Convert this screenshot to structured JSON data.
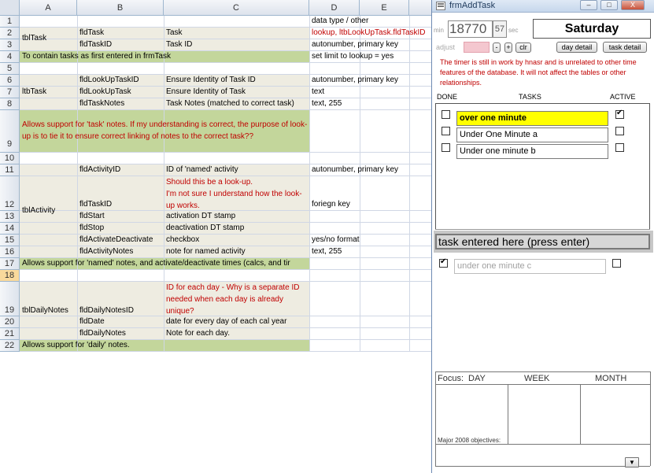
{
  "sheet": {
    "columns": [
      "A",
      "B",
      "C",
      "D",
      "E"
    ],
    "rows": [
      "1",
      "2",
      "3",
      "4",
      "5",
      "6",
      "7",
      "8",
      "9",
      "10",
      "11",
      "12",
      "13",
      "14",
      "15",
      "16",
      "17",
      "18",
      "19",
      "20",
      "21",
      "22"
    ],
    "cells": {
      "d1": "data type / other",
      "a2": "tblTask",
      "b2": "fldTask",
      "c2": "Task",
      "d2": "lookup, ltbLookUpTask.fldTaskID",
      "b3": "fldTaskID",
      "c3": "Task ID",
      "d3": "autonumber, primary key",
      "a4": "To contain tasks as first entered in frmTask",
      "d4": "set limit to lookup = yes",
      "a7": "ltbTask",
      "b6": "fldLookUpTaskID",
      "c6": "Ensure Identity of Task ID",
      "d6": "autonumber, primary key",
      "b7": "fldLookUpTask",
      "c7": "Ensure Identity of Task",
      "d7": "text",
      "b8": "fldTaskNotes",
      "c8": "Task Notes (matched to correct task)",
      "d8": "text, 255",
      "a9": "Allows support for 'task' notes.  If my understanding is correct, the purpose of look-up is to tie it to ensure correct linking of notes to the correct task??",
      "b11": "fldActivityID",
      "c11": "ID of 'named' activity",
      "d11": "autonumber, primary key",
      "a13": "tblActivity",
      "c12a": "Should this be a look-up.",
      "c12b": "I'm not sure I understand how the look-up works.",
      "b12": "fldTaskID",
      "d12": "foriegn key",
      "b13": "fldStart",
      "c13": "activation DT stamp",
      "b14": "fldStop",
      "c14": "deactivation DT stamp",
      "b15": "fldActivateDeactivate",
      "c15": "checkbox",
      "d15": "yes/no format",
      "b16": "fldActivityNotes",
      "c16": "note for named activity",
      "d16": "text, 255",
      "a17": "Allows support for 'named' notes, and activate/deactivate times (calcs, and tir",
      "c19": "ID for each day - Why is a separate ID needed when each day is already unique?",
      "a19": "tblDailyNotes",
      "b19": "fldDailyNotesID",
      "b20": "fldDate",
      "c20": "date for every day of each cal year",
      "b21": "fldDailyNotes",
      "c21": "Note for each day.",
      "a22": "Allows support for 'daily' notes."
    }
  },
  "form": {
    "title": "frmAddTask",
    "window_buttons": [
      "–",
      "□",
      "X"
    ],
    "timer_min_label": "min",
    "timer_minutes": "18770",
    "timer_seconds": "57",
    "timer_sec_label": "sec",
    "day": "Saturday",
    "adjust_label": "adjust",
    "minus_label": "-",
    "plus_label": "+",
    "clr_label": "clr",
    "day_detail_label": "day detail",
    "task_detail_label": "task detail",
    "note": "The timer is still in work by hnasr and is unrelated to other time features of the database.  It will not affect the tables or other relationships.",
    "headers": {
      "done": "DONE",
      "tasks": "TASKS",
      "active": "ACTIVE"
    },
    "tasks": [
      {
        "text": "over one minute",
        "done": false,
        "active": true,
        "highlight": "#ffff00"
      },
      {
        "text": "Under One Minute a",
        "done": false,
        "active": false
      },
      {
        "text": "Under one minute b",
        "done": false,
        "active": false
      }
    ],
    "task_entry": "task entered here (press enter)",
    "completed_task": {
      "text": "under one minute c",
      "done": true,
      "active": false
    },
    "focus_label": "Focus:",
    "focus_day": "DAY",
    "focus_week": "WEEK",
    "focus_month": "MONTH",
    "objectives_label": "Major 2008 objectives:",
    "scroll_glyph": "▼"
  },
  "colors": {
    "tan": "#eeece1",
    "green": "#c3d69b",
    "red_text": "#c00000",
    "highlight": "#ffff00"
  }
}
